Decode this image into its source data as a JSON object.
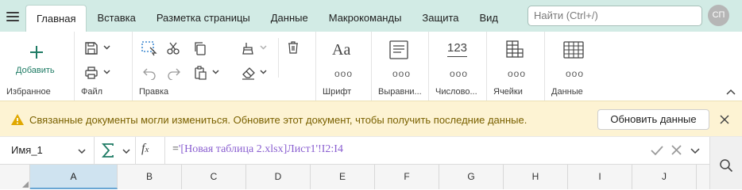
{
  "tabs": [
    "Главная",
    "Вставка",
    "Разметка страницы",
    "Данные",
    "Макрокоманды",
    "Защита",
    "Вид"
  ],
  "search": {
    "placeholder": "Найти (Ctrl+/)"
  },
  "user": {
    "initials": "СП"
  },
  "ribbon": {
    "add_label": "Добавить",
    "groups": {
      "favorites": "Избранное",
      "file": "Файл",
      "edit": "Правка",
      "font": "Шрифт",
      "align": "Выравни...",
      "number": "Числово...",
      "cells": "Ячейки",
      "data": "Данные"
    },
    "number_icon_text": "123",
    "font_icon_text": "Aa"
  },
  "warning": {
    "message": "Связанные документы могли измениться. Обновите этот документ, чтобы получить последние данные.",
    "button": "Обновить данные"
  },
  "formula_bar": {
    "name_box": "Имя_1",
    "equals": "=",
    "formula": "'[Новая таблица 2.xlsx]Лист1'!I2:I4"
  },
  "columns": [
    "A",
    "B",
    "C",
    "D",
    "E",
    "F",
    "G",
    "H",
    "I",
    "J"
  ],
  "selected_column": "A",
  "colors": {
    "accent": "#1e7b64",
    "topbar": "#d2ebe5",
    "warning_bg": "#fdf3d3",
    "warning_text": "#7a6100",
    "formula_ref": "#8a5fd0"
  }
}
